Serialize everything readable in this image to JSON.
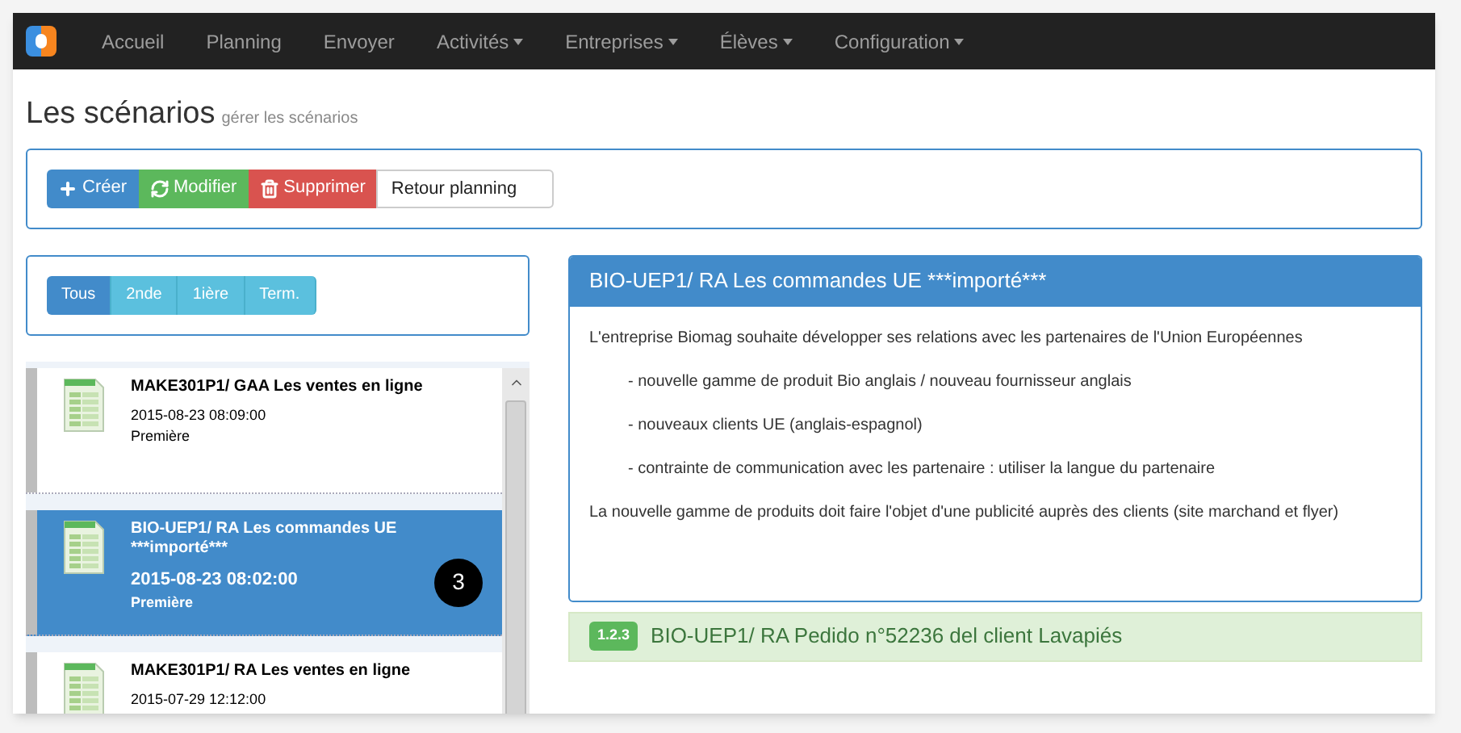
{
  "navbar": {
    "items": [
      {
        "label": "Accueil",
        "dropdown": false
      },
      {
        "label": "Planning",
        "dropdown": false
      },
      {
        "label": "Envoyer",
        "dropdown": false
      },
      {
        "label": "Activités",
        "dropdown": true
      },
      {
        "label": "Entreprises",
        "dropdown": true
      },
      {
        "label": "Élèves",
        "dropdown": true
      },
      {
        "label": "Configuration",
        "dropdown": true
      }
    ]
  },
  "page": {
    "title": "Les scénarios",
    "subtitle": "gérer les scénarios"
  },
  "toolbar": {
    "buttons": [
      {
        "label": "Créer",
        "kind": "create"
      },
      {
        "label": "Modifier",
        "kind": "edit"
      },
      {
        "label": "Supprimer",
        "kind": "delete"
      }
    ],
    "field": {
      "value": "Retour planning"
    }
  },
  "filters": [
    {
      "label": "Tous",
      "selected": true
    },
    {
      "label": "2nde",
      "selected": false
    },
    {
      "label": "1ière",
      "selected": false
    },
    {
      "label": "Term.",
      "selected": false
    }
  ],
  "scenarios": [
    {
      "title": "MAKE301P1/ GAA Les ventes en ligne",
      "date": "2015-08-23 08:09:00",
      "level": "Première",
      "selected": false
    },
    {
      "title": "BIO-UEP1/ RA Les commandes UE ***importé***",
      "date": "2015-08-23 08:02:00",
      "level": "Première",
      "selected": true,
      "callout": "3"
    },
    {
      "title": "MAKE301P1/ RA Les ventes en ligne",
      "date": "2015-07-29 12:12:00",
      "selected": false
    }
  ],
  "detail": {
    "title": "BIO-UEP1/ RA Les commandes UE ***importé***",
    "paragraphs": [
      {
        "text": "L'entreprise Biomag souhaite développer ses relations avec les partenaires de l'Union Européennes",
        "indent": false
      },
      {
        "text": "- nouvelle gamme de produit Bio anglais / nouveau fournisseur anglais",
        "indent": true
      },
      {
        "text": "- nouveaux clients UE (anglais-espagnol)",
        "indent": true
      },
      {
        "text": "- contrainte de communication avec les partenaire : utiliser la langue du partenaire",
        "indent": true
      },
      {
        "text": "La nouvelle gamme de produits doit faire l'objet d'une publicité auprès des clients (site marchand et flyer)",
        "indent": false
      }
    ]
  },
  "next_activity": {
    "badge": "1.2.3",
    "title": "BIO-UEP1/ RA Pedido n°52236 del client Lavapiés"
  }
}
